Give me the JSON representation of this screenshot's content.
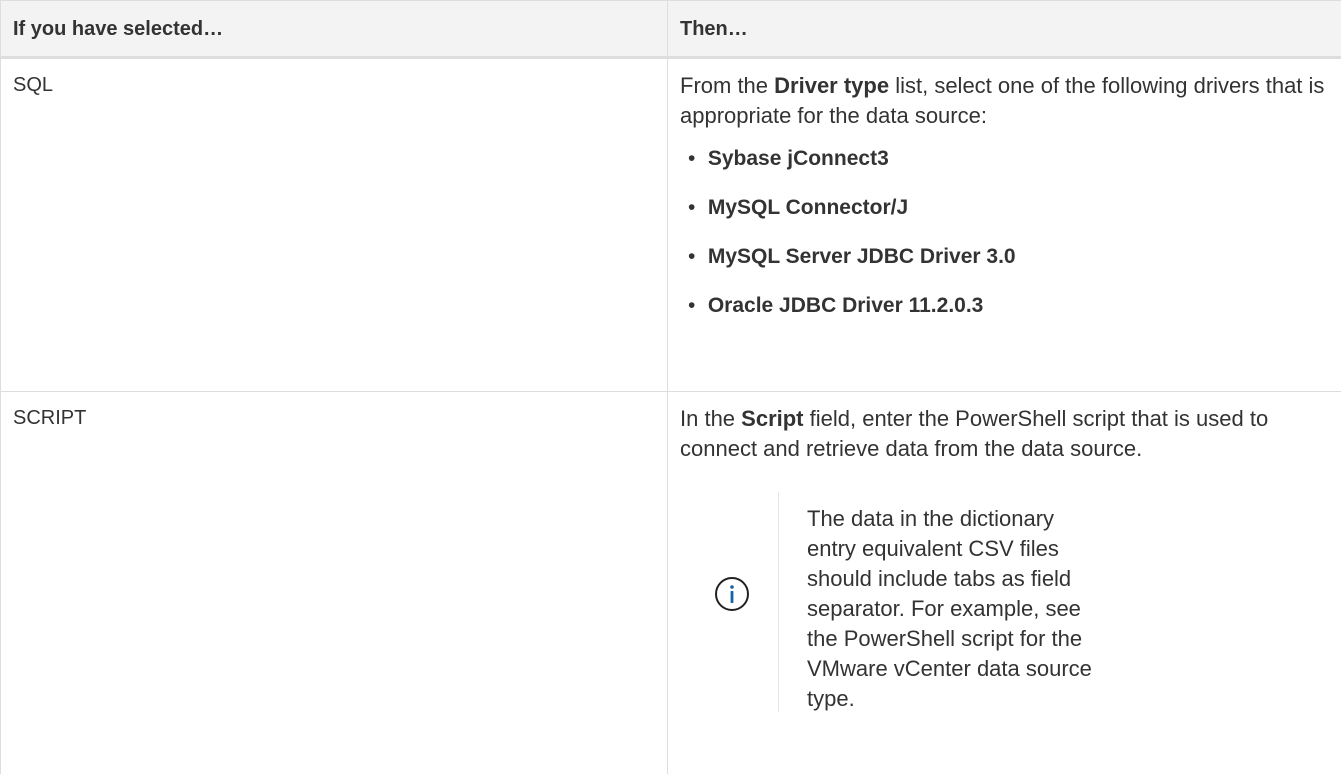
{
  "table": {
    "headers": [
      "If you have selected…",
      "Then…"
    ],
    "rows": [
      {
        "selection": "SQL",
        "intro_prefix": "From the ",
        "intro_bold": "Driver type",
        "intro_suffix": " list, select one of the following drivers that is appropriate for the data source:",
        "drivers": [
          "Sybase jConnect3",
          "MySQL Connector/J",
          "MySQL Server JDBC Driver 3.0",
          "Oracle JDBC Driver 11.2.0.3"
        ]
      },
      {
        "selection": "SCRIPT",
        "intro_prefix": "In the ",
        "intro_bold": "Script",
        "intro_suffix": " field, enter the PowerShell script that is used to connect and retrieve data from the data source.",
        "note": {
          "icon": "info-icon",
          "text": "The data in the dictionary entry equivalent CSV files should include tabs as field separator. For example, see the PowerShell script for the VMware vCenter data source type."
        }
      }
    ]
  },
  "colors": {
    "header_bg": "#f3f3f3",
    "border": "#dddddd",
    "text": "#333333",
    "info_icon": "#1563a3"
  }
}
